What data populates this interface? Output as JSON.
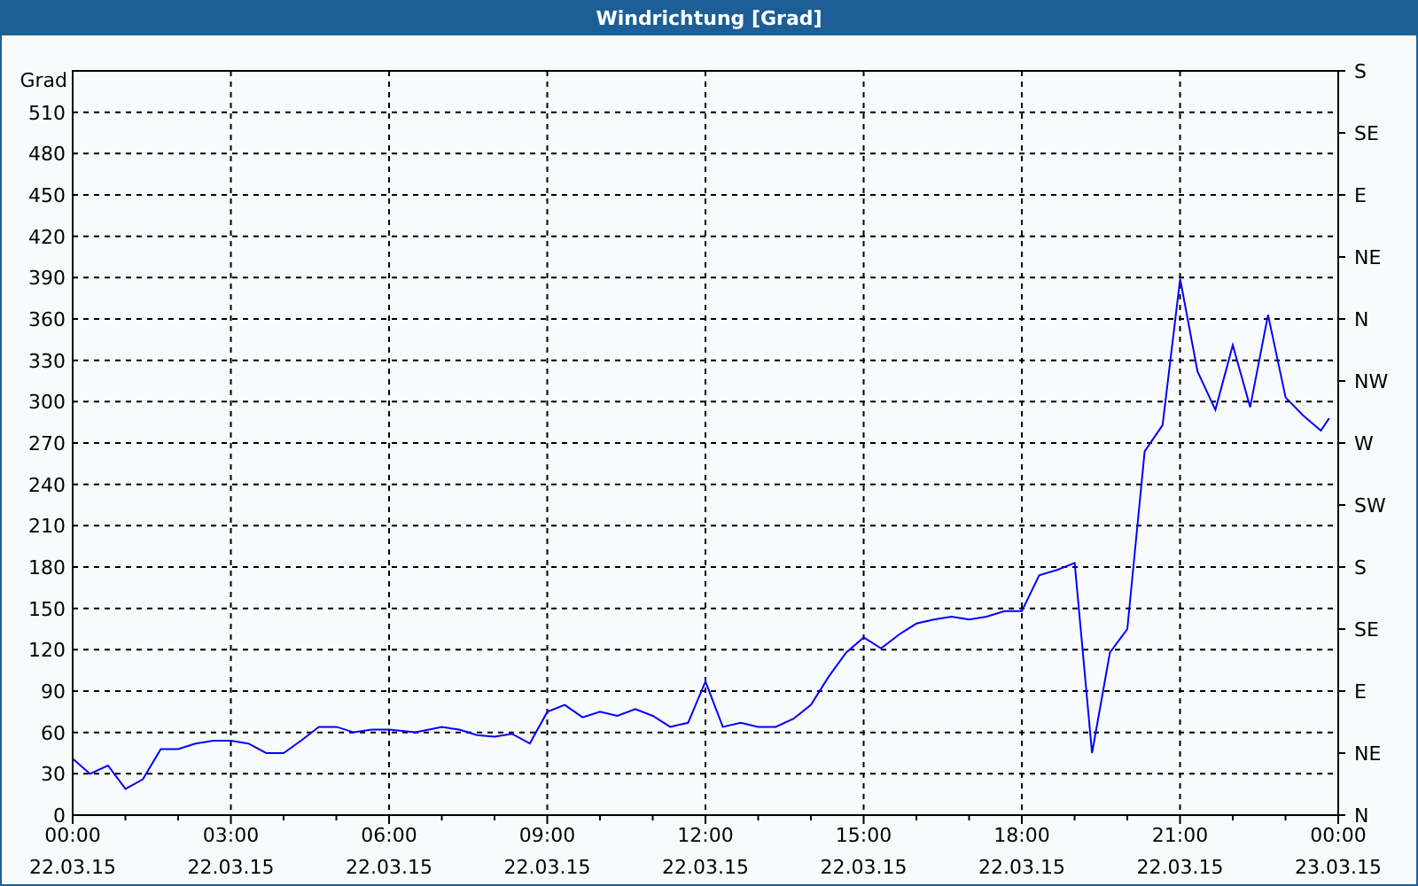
{
  "window": {
    "title": "Windrichtung [Grad]"
  },
  "chart": {
    "chart_data": {
      "type": "line",
      "ylabel": "Grad",
      "xlim": [
        0,
        24
      ],
      "ylim": [
        0,
        540
      ],
      "grid": true,
      "yticks": [
        0,
        30,
        60,
        90,
        120,
        150,
        180,
        210,
        240,
        270,
        300,
        330,
        360,
        390,
        420,
        450,
        480,
        510
      ],
      "xticks": [
        {
          "value": 0,
          "label": "00:00"
        },
        {
          "value": 3,
          "label": "03:00"
        },
        {
          "value": 6,
          "label": "06:00"
        },
        {
          "value": 9,
          "label": "09:00"
        },
        {
          "value": 12,
          "label": "12:00"
        },
        {
          "value": 15,
          "label": "15:00"
        },
        {
          "value": 18,
          "label": "18:00"
        },
        {
          "value": 21,
          "label": "21:00"
        },
        {
          "value": 24,
          "label": "00:00"
        }
      ],
      "x": [
        0,
        0.33,
        0.67,
        1,
        1.33,
        1.67,
        2,
        2.33,
        2.67,
        3,
        3.33,
        3.67,
        4,
        4.33,
        4.67,
        5,
        5.33,
        5.67,
        6,
        6.5,
        7,
        7.33,
        7.67,
        8,
        8.33,
        8.67,
        9,
        9.33,
        9.67,
        10,
        10.33,
        10.67,
        11,
        11.33,
        11.67,
        12,
        12.33,
        12.67,
        13,
        13.33,
        13.67,
        14,
        14.33,
        14.67,
        15,
        15.33,
        15.67,
        16,
        16.33,
        16.67,
        17,
        17.33,
        17.67,
        18,
        18.33,
        18.67,
        19,
        19.33,
        19.67,
        20,
        20.33,
        20.67,
        21,
        21.33,
        21.67,
        22,
        22.33,
        22.67,
        23,
        23.33,
        23.67,
        23.83
      ],
      "series": [
        {
          "color": "#0000ff",
          "values": [
            41,
            30,
            36,
            19,
            26,
            48,
            48,
            52,
            54,
            54,
            52,
            45,
            45,
            54,
            64,
            64,
            60,
            62,
            62,
            60,
            64,
            62,
            58,
            57,
            59,
            52,
            75,
            80,
            71,
            75,
            72,
            77,
            72,
            64,
            67,
            97,
            64,
            67,
            64,
            64,
            70,
            80,
            100,
            118,
            129,
            121,
            131,
            139,
            142,
            144,
            142,
            144,
            148,
            148,
            174,
            178,
            183,
            45,
            118,
            135,
            264,
            283,
            389,
            322,
            294,
            341,
            296,
            363,
            303,
            290,
            279,
            288
          ]
        }
      ]
    },
    "x_date_labels": [
      "22.03.15",
      "22.03.15",
      "22.03.15",
      "22.03.15",
      "22.03.15",
      "22.03.15",
      "22.03.15",
      "22.03.15",
      "23.03.15"
    ],
    "right_axis_labels": [
      "S",
      "SE",
      "E",
      "NE",
      "N",
      "NW",
      "W",
      "SW",
      "S",
      "SE",
      "E",
      "NE",
      "N"
    ]
  }
}
